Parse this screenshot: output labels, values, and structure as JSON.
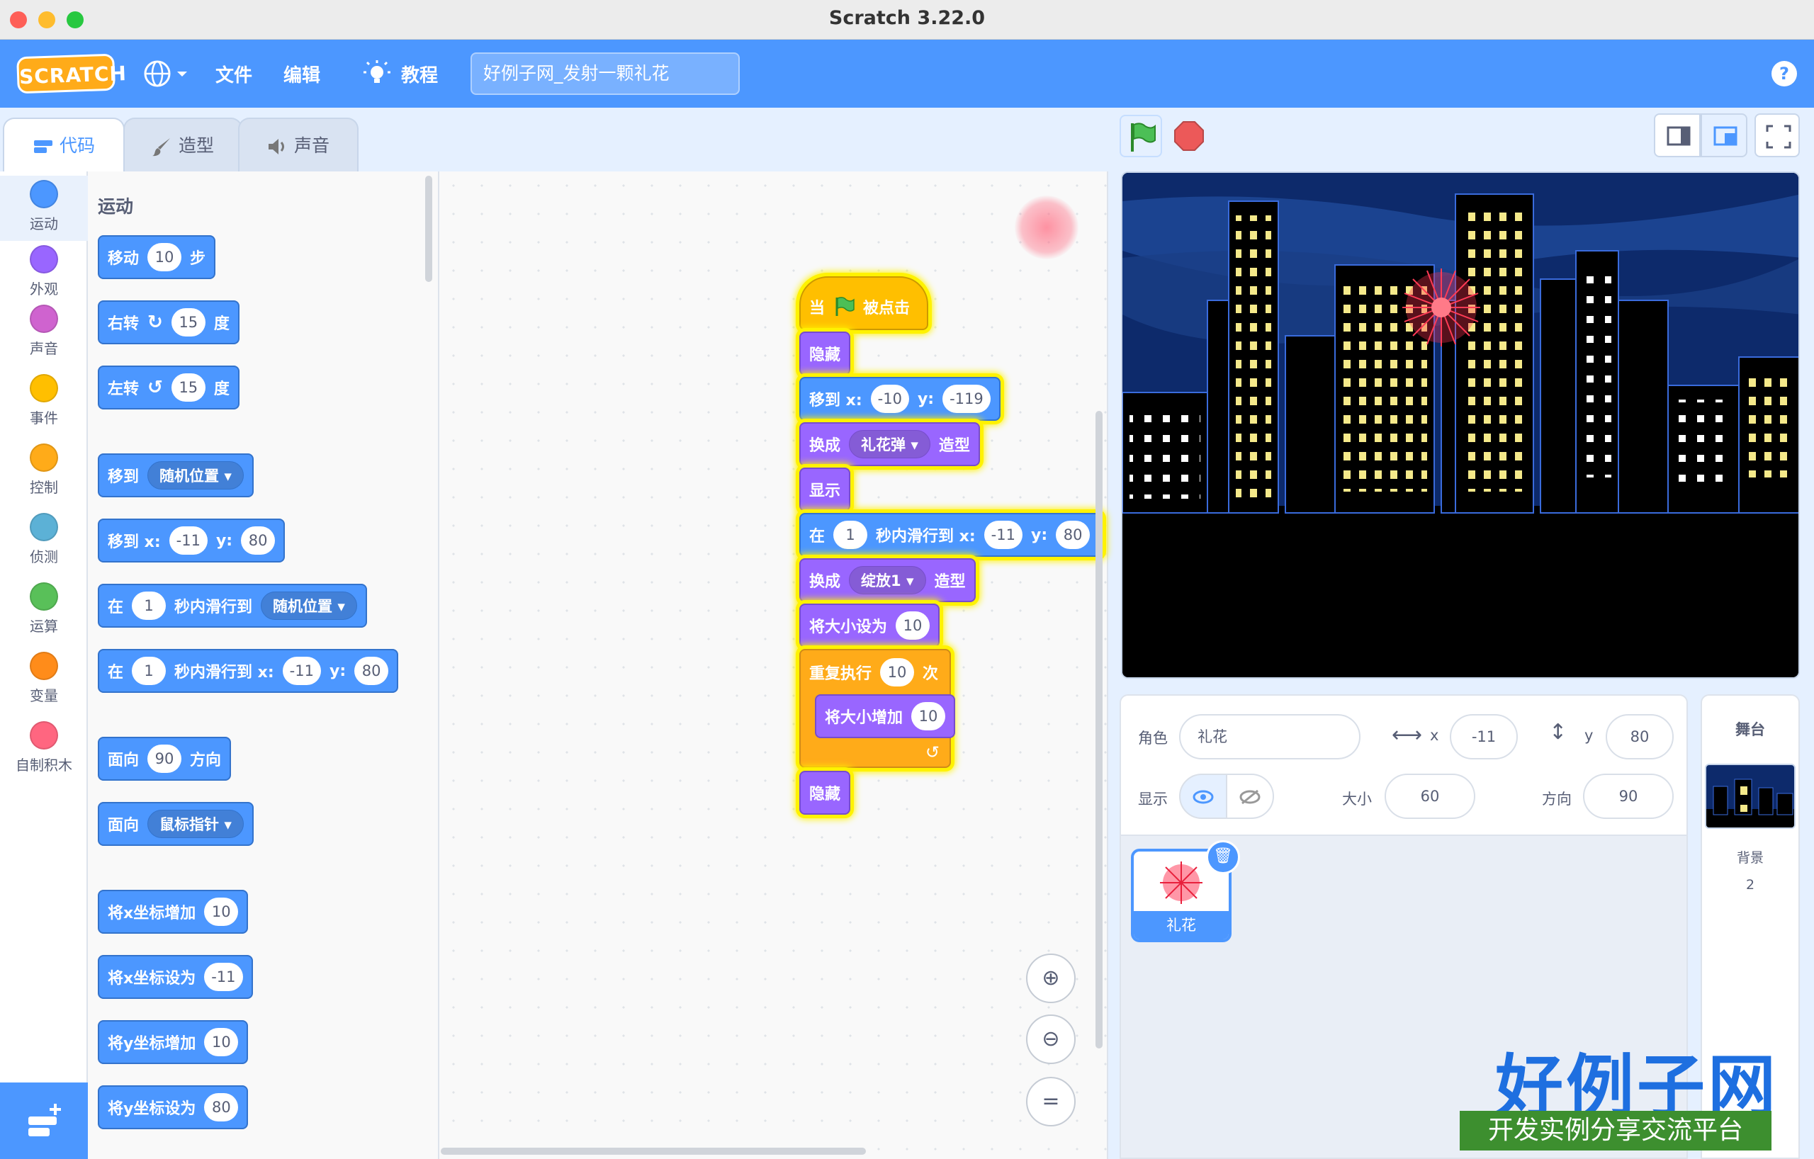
{
  "window": {
    "title": "Scratch 3.22.0"
  },
  "menubar": {
    "logo": "SCRATCH",
    "file": "文件",
    "edit": "编辑",
    "tutorials": "教程",
    "project_title": "好例子网_发射一颗礼花",
    "help": "?"
  },
  "tabs": {
    "code": "代码",
    "costumes": "造型",
    "sounds": "声音"
  },
  "categories": [
    {
      "label": "运动",
      "color": "#4c97ff"
    },
    {
      "label": "外观",
      "color": "#9966ff"
    },
    {
      "label": "声音",
      "color": "#cf63cf"
    },
    {
      "label": "事件",
      "color": "#ffbf00"
    },
    {
      "label": "控制",
      "color": "#ffab19"
    },
    {
      "label": "侦测",
      "color": "#5cb1d6"
    },
    {
      "label": "运算",
      "color": "#59c059"
    },
    {
      "label": "变量",
      "color": "#ff8c1a"
    },
    {
      "label": "自制积木",
      "color": "#ff6680"
    }
  ],
  "palette": {
    "title": "运动",
    "move": {
      "a": "移动",
      "v": "10",
      "b": "步"
    },
    "turn_right": {
      "a": "右转",
      "v": "15",
      "b": "度"
    },
    "turn_left": {
      "a": "左转",
      "v": "15",
      "b": "度"
    },
    "goto": {
      "a": "移到",
      "d": "随机位置"
    },
    "goto_xy": {
      "a": "移到 x:",
      "x": "-11",
      "b": "y:",
      "y": "80"
    },
    "glide": {
      "a": "在",
      "v": "1",
      "b": "秒内滑行到",
      "d": "随机位置"
    },
    "glide_xy": {
      "a": "在",
      "v": "1",
      "b": "秒内滑行到 x:",
      "x": "-11",
      "c": "y:",
      "y": "80"
    },
    "point_dir": {
      "a": "面向",
      "v": "90",
      "b": "方向"
    },
    "point_towards": {
      "a": "面向",
      "d": "鼠标指针"
    },
    "change_x": {
      "a": "将x坐标增加",
      "v": "10"
    },
    "set_x": {
      "a": "将x坐标设为",
      "v": "-11"
    },
    "change_y": {
      "a": "将y坐标增加",
      "v": "10"
    },
    "set_y": {
      "a": "将y坐标设为",
      "v": "80"
    }
  },
  "script": {
    "hat": {
      "a": "当",
      "b": "被点击"
    },
    "hide1": "隐藏",
    "goto": {
      "a": "移到 x:",
      "x": "-10",
      "b": "y:",
      "y": "-119"
    },
    "costume1": {
      "a": "换成",
      "d": "礼花弹",
      "b": "造型"
    },
    "show": "显示",
    "glide": {
      "a": "在",
      "v": "1",
      "b": "秒内滑行到 x:",
      "x": "-11",
      "c": "y:",
      "y": "80"
    },
    "costume2": {
      "a": "换成",
      "d": "绽放1",
      "b": "造型"
    },
    "setsize": {
      "a": "将大小设为",
      "v": "10"
    },
    "repeat": {
      "a": "重复执行",
      "v": "10",
      "b": "次"
    },
    "changesize": {
      "a": "将大小增加",
      "v": "10"
    },
    "hide2": "隐藏"
  },
  "sprite_info": {
    "sprite_label": "角色",
    "sprite_name": "礼花",
    "x_label": "x",
    "x": "-11",
    "y_label": "y",
    "y": "80",
    "show_label": "显示",
    "size_label": "大小",
    "size": "60",
    "direction_label": "方向",
    "direction": "90"
  },
  "sprites": [
    {
      "name": "礼花"
    }
  ],
  "stage_panel": {
    "title": "舞台",
    "backdrops_label": "背景",
    "backdrops_count": "2"
  },
  "watermark": {
    "title": "好例子网",
    "subtitle": "开发实例分享交流平台"
  },
  "colors": {
    "motion": "#4c97ff",
    "looks": "#9966ff",
    "control": "#ffab19",
    "events": "#ffbf00",
    "menubar": "#4c97ff",
    "highlight": "#fff200"
  }
}
